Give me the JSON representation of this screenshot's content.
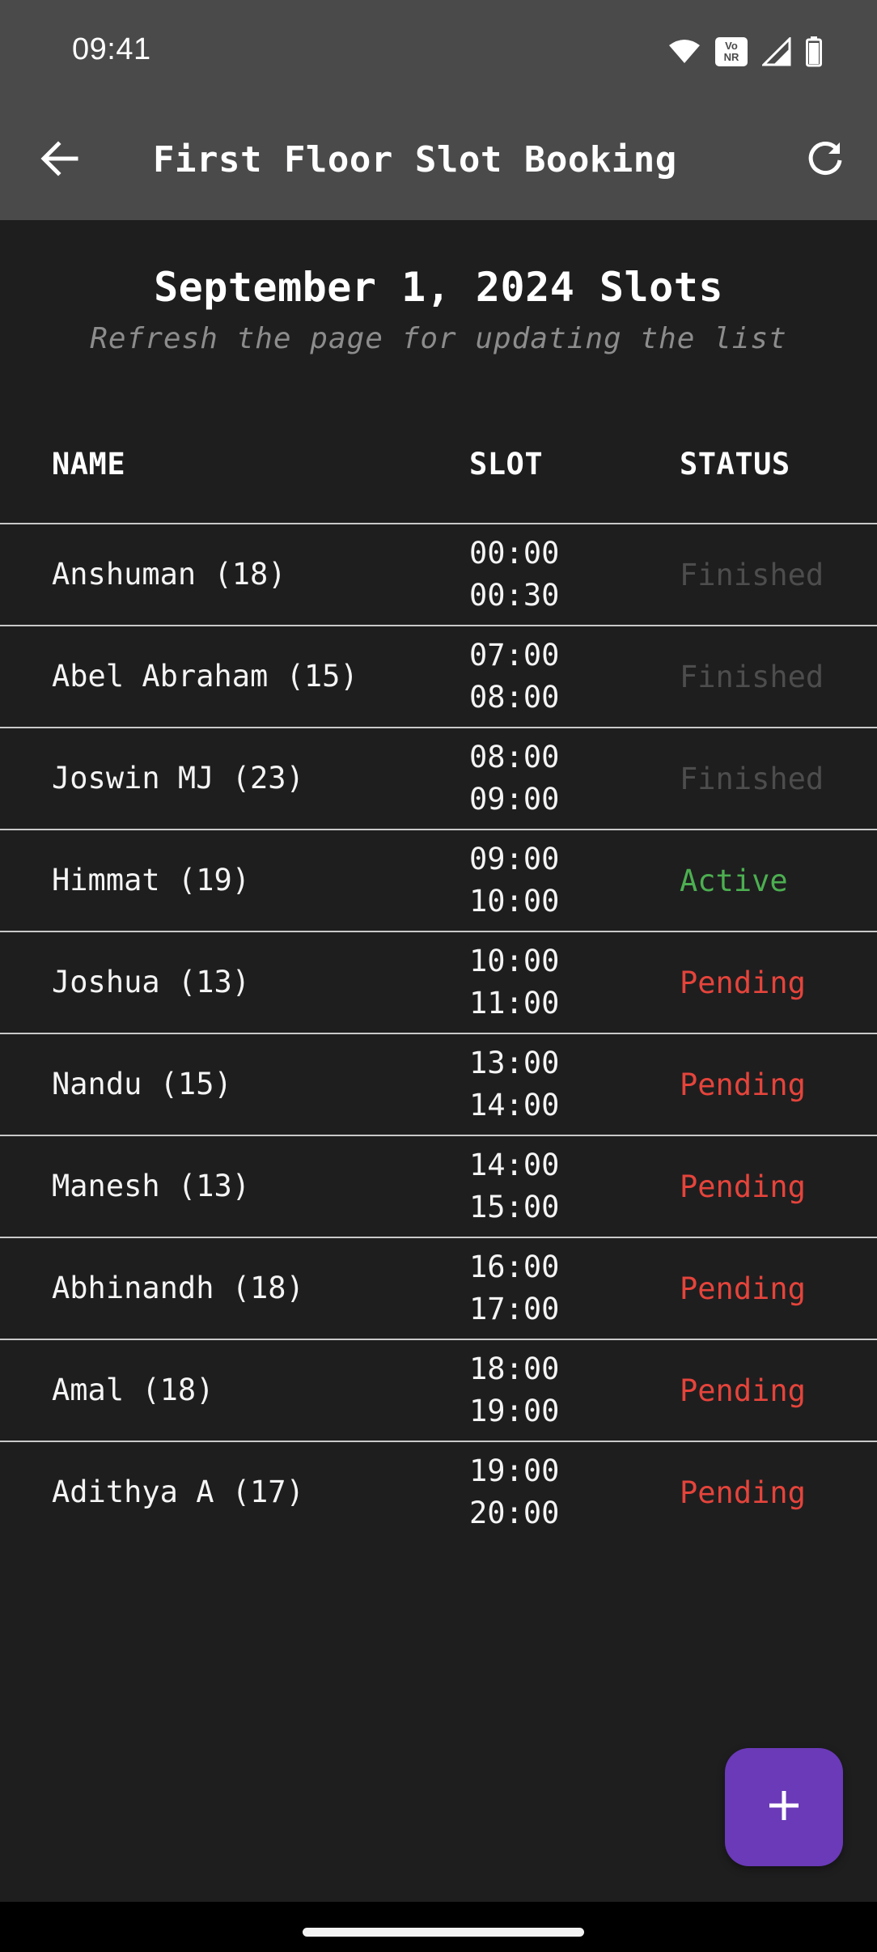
{
  "status_bar": {
    "time": "09:41",
    "icons": [
      "wifi-icon",
      "vonr-icon",
      "signal-icon",
      "battery-icon"
    ],
    "vonr_label_top": "Vo",
    "vonr_label_bottom": "NR"
  },
  "app_bar": {
    "title": "First Floor Slot Booking",
    "back_icon": "arrow-left-icon",
    "refresh_icon": "refresh-icon"
  },
  "heading": {
    "title": "September 1, 2024 Slots",
    "subtitle": "Refresh the page for updating the list"
  },
  "table": {
    "columns": [
      "NAME",
      "SLOT",
      "STATUS"
    ],
    "rows": [
      {
        "name": "Anshuman (18)",
        "start": "00:00",
        "end": "00:30",
        "status": "Finished"
      },
      {
        "name": "Abel Abraham (15)",
        "start": "07:00",
        "end": "08:00",
        "status": "Finished"
      },
      {
        "name": "Joswin MJ (23)",
        "start": "08:00",
        "end": "09:00",
        "status": "Finished"
      },
      {
        "name": "Himmat (19)",
        "start": "09:00",
        "end": "10:00",
        "status": "Active"
      },
      {
        "name": "Joshua (13)",
        "start": "10:00",
        "end": "11:00",
        "status": "Pending"
      },
      {
        "name": "Nandu (15)",
        "start": "13:00",
        "end": "14:00",
        "status": "Pending"
      },
      {
        "name": "Manesh (13)",
        "start": "14:00",
        "end": "15:00",
        "status": "Pending"
      },
      {
        "name": "Abhinandh (18)",
        "start": "16:00",
        "end": "17:00",
        "status": "Pending"
      },
      {
        "name": "Amal (18)",
        "start": "18:00",
        "end": "19:00",
        "status": "Pending"
      },
      {
        "name": "Adithya A (17)",
        "start": "19:00",
        "end": "20:00",
        "status": "Pending"
      }
    ]
  },
  "status_colors": {
    "Finished": "#4d4d4e",
    "Active": "#4caf50",
    "Pending": "#e5443b"
  },
  "fab": {
    "icon": "plus-icon",
    "color": "#6a3ab8"
  },
  "colors": {
    "app_bar": "#4a4a4b",
    "background": "#1e1e1f"
  }
}
